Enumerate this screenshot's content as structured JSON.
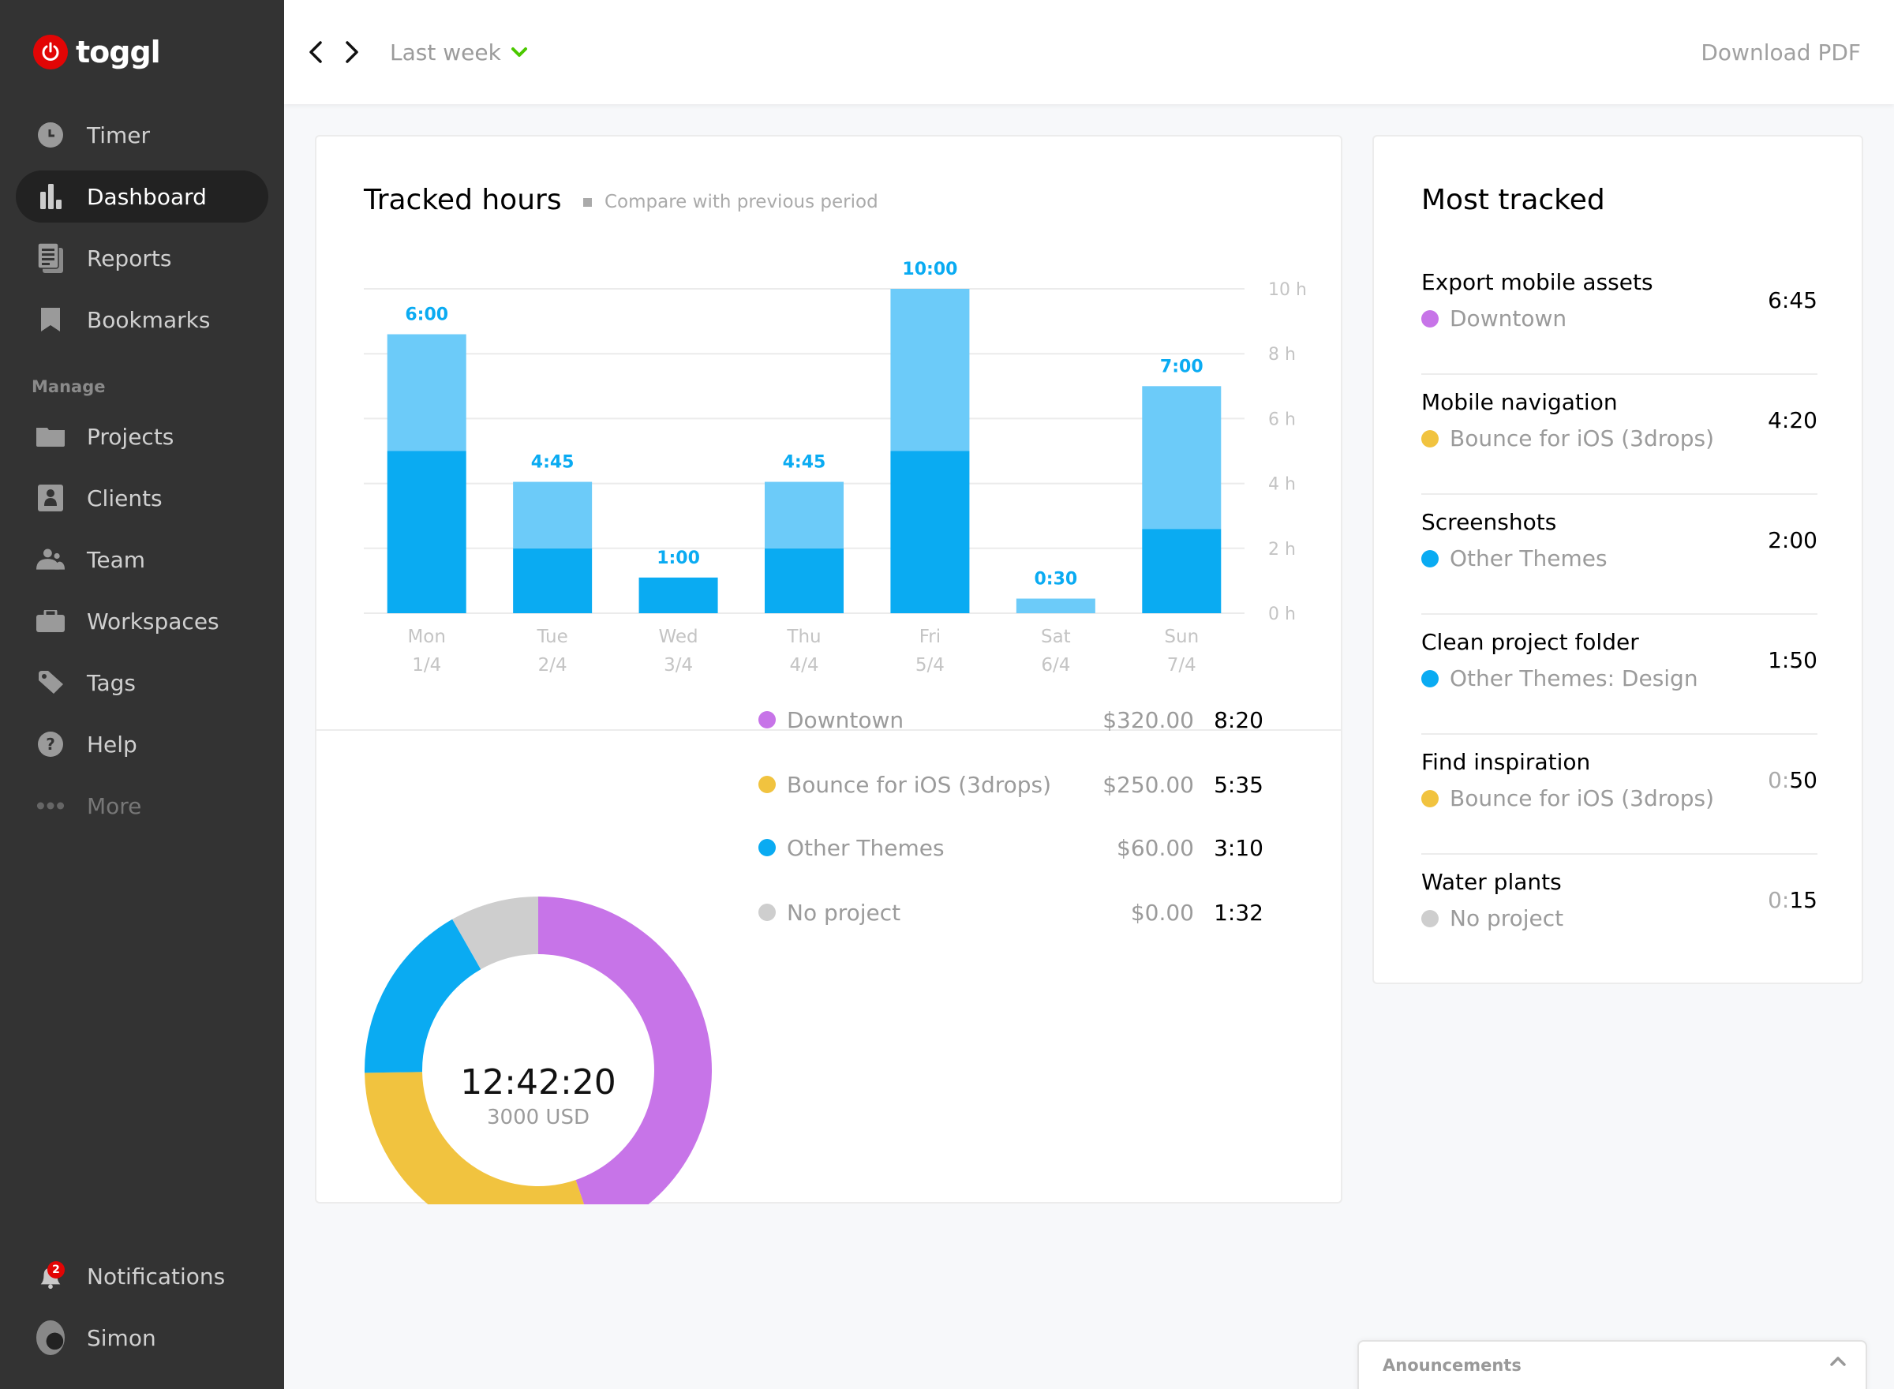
{
  "app": {
    "brand": "toggl",
    "brand_color": "#e20505"
  },
  "sidebar": {
    "items": [
      {
        "label": "Timer",
        "icon": "clock-icon"
      },
      {
        "label": "Dashboard",
        "icon": "bar-chart-icon",
        "active": true
      },
      {
        "label": "Reports",
        "icon": "reports-icon"
      },
      {
        "label": "Bookmarks",
        "icon": "bookmark-icon"
      }
    ],
    "section_label": "Manage",
    "manage_items": [
      {
        "label": "Projects",
        "icon": "folder-icon"
      },
      {
        "label": "Clients",
        "icon": "client-icon"
      },
      {
        "label": "Team",
        "icon": "team-icon"
      },
      {
        "label": "Workspaces",
        "icon": "briefcase-icon"
      },
      {
        "label": "Tags",
        "icon": "tag-icon"
      },
      {
        "label": "Help",
        "icon": "help-icon"
      },
      {
        "label": "More",
        "icon": "more-icon"
      }
    ],
    "notifications": {
      "label": "Notifications",
      "count": "2"
    },
    "user": {
      "name": "Simon"
    }
  },
  "header": {
    "period": "Last week",
    "download_label": "Download PDF",
    "accent": "#4bc800"
  },
  "tracked_hours": {
    "title": "Tracked hours",
    "compare_label": "Compare with previous period"
  },
  "chart_data": [
    {
      "type": "bar",
      "title": "Tracked hours",
      "stacked": true,
      "categories": [
        "Mon",
        "Tue",
        "Wed",
        "Thu",
        "Fri",
        "Sat",
        "Sun"
      ],
      "dates": [
        "1/4",
        "2/4",
        "3/4",
        "4/4",
        "5/4",
        "6/4",
        "7/4"
      ],
      "labels": [
        "6:00",
        "4:45",
        "1:00",
        "4:45",
        "10:00",
        "0:30",
        "7:00"
      ],
      "series": [
        {
          "name": "dark",
          "color": "#0aabf2",
          "values": [
            5.0,
            2.0,
            1.1,
            2.0,
            5.0,
            0,
            2.6
          ]
        },
        {
          "name": "light",
          "color": "#6ccbf9",
          "values": [
            3.6,
            2.05,
            0,
            2.05,
            5.0,
            0.45,
            4.4
          ]
        }
      ],
      "yticks": [
        "0 h",
        "2 h",
        "4 h",
        "6 h",
        "8 h",
        "10 h"
      ],
      "ylim": [
        0,
        10
      ],
      "grid": true,
      "label_color": "#0aabf2"
    },
    {
      "type": "pie",
      "donut": true,
      "center_primary": "12:42:20",
      "center_secondary": "3000 USD",
      "slices": [
        {
          "name": "Downtown",
          "amount": "$320.00",
          "time": "8:20",
          "minutes": 500,
          "color": "#c774e8"
        },
        {
          "name": "Bounce for iOS (3drops)",
          "amount": "$250.00",
          "time": "5:35",
          "minutes": 335,
          "color": "#f1c33f"
        },
        {
          "name": "Other Themes",
          "amount": "$60.00",
          "time": "3:10",
          "minutes": 190,
          "color": "#0aabf2"
        },
        {
          "name": "No project",
          "amount": "$0.00",
          "time": "1:32",
          "minutes": 92,
          "color": "#cecece"
        }
      ]
    }
  ],
  "most_tracked": {
    "title": "Most tracked",
    "items": [
      {
        "task": "Export mobile assets",
        "project": "Downtown",
        "color": "#c774e8",
        "dur_prefix": "",
        "dur": "6:45"
      },
      {
        "task": "Mobile navigation",
        "project": "Bounce for iOS (3drops)",
        "color": "#f1c33f",
        "dur_prefix": "",
        "dur": "4:20"
      },
      {
        "task": "Screenshots",
        "project": "Other Themes",
        "color": "#0aabf2",
        "dur_prefix": "",
        "dur": "2:00"
      },
      {
        "task": "Clean project folder",
        "project": "Other Themes: Design",
        "color": "#0aabf2",
        "dur_prefix": "",
        "dur": "1:50"
      },
      {
        "task": "Find inspiration",
        "project": "Bounce for iOS (3drops)",
        "color": "#f1c33f",
        "dur_prefix": "0:",
        "dur": "50"
      },
      {
        "task": "Water plants",
        "project": "No project",
        "color": "#cecece",
        "dur_prefix": "0:",
        "dur": "15"
      }
    ]
  },
  "announcements": {
    "label": "Anouncements"
  }
}
